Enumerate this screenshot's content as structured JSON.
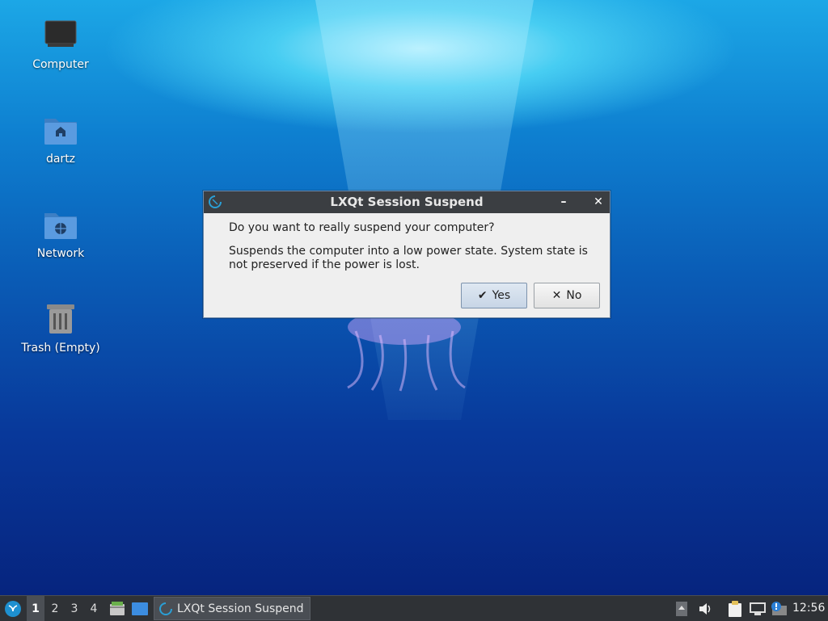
{
  "desktop": {
    "icons": [
      {
        "label": "Computer"
      },
      {
        "label": "dartz"
      },
      {
        "label": "Network"
      },
      {
        "label": "Trash (Empty)"
      }
    ]
  },
  "dialog": {
    "title": "LXQt Session Suspend",
    "minimize_glyph": "–",
    "close_glyph": "✕",
    "question": "Do you want to really suspend your computer?",
    "description": "Suspends the computer into a low power state. System state is not preserved if the power is lost.",
    "yes_label": "Yes",
    "no_label": "No"
  },
  "taskbar": {
    "desktops": [
      "1",
      "2",
      "3",
      "4"
    ],
    "active_desktop": "1",
    "task_title": "LXQt Session Suspend",
    "clock": "12:56"
  },
  "colors": {
    "titlebar": "#3b3e42",
    "taskbar": "#2f3236",
    "dialog_bg": "#efefef",
    "accent": "#1e90d0"
  }
}
